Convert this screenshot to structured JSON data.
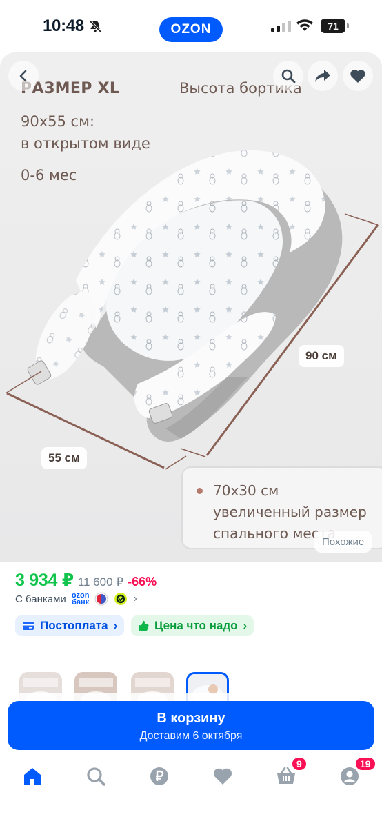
{
  "status_bar": {
    "time": "10:48",
    "battery": "71",
    "brand": "OZON"
  },
  "gallery": {
    "photo_text": {
      "title": "РАЗМЕР XL",
      "side_height": "Высота бортика",
      "size": "90х55 см:\nв открытом виде",
      "age": "0-6 мес",
      "dim_length": "90 см",
      "dim_width": "55 см",
      "info_lines": [
        "70х30 см",
        "увеличенный размер",
        "спального места"
      ]
    },
    "similar_label": "Похожие"
  },
  "price": {
    "current": "3 934 ₽",
    "old": "11 600 ₽",
    "discount": "-66%",
    "banks_label": "С банками",
    "bank_logo_line1": "ozon",
    "bank_logo_line2": "банк"
  },
  "chips": {
    "postpay": "Постоплата",
    "fair_price": "Цена что надо"
  },
  "cart": {
    "label": "В корзину",
    "delivery": "Доставим 6 октября"
  },
  "tabbar": {
    "cart_badge": "9",
    "profile_badge": "19"
  },
  "colors": {
    "accent": "#005bff",
    "price_green": "#10c44c",
    "discount_pink": "#f91155"
  }
}
